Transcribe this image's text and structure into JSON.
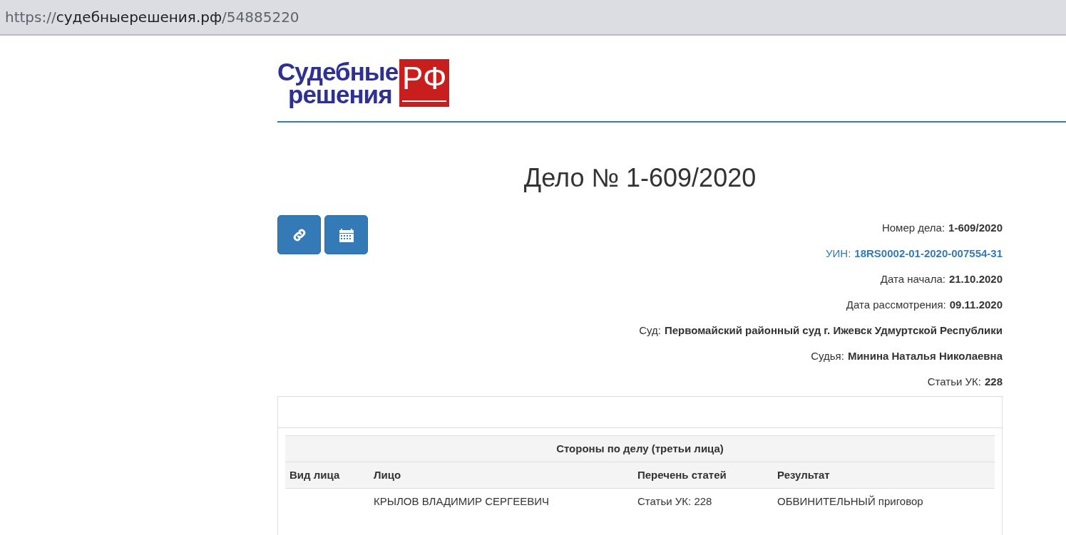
{
  "address_bar": {
    "scheme": "https://",
    "host": "судебныерешения.рф",
    "path": "/54885220"
  },
  "logo": {
    "line1": "Судебные",
    "line2": "решения",
    "badge": "РФ"
  },
  "title": "Дело № 1-609/2020",
  "action_buttons": [
    {
      "kind": "link"
    },
    {
      "kind": "calendar"
    }
  ],
  "fields": [
    {
      "label": "Номер дела:",
      "value": "1-609/2020",
      "kind": "text"
    },
    {
      "label": "УИН:",
      "value": "18RS0002-01-2020-007554-31",
      "kind": "link"
    },
    {
      "label": "Дата начала:",
      "value": "21.10.2020",
      "kind": "text"
    },
    {
      "label": "Дата рассмотрения:",
      "value": "09.11.2020",
      "kind": "text"
    },
    {
      "label": "Суд:",
      "value": "Первомайский районный суд г. Ижевск Удмуртской Республики",
      "kind": "text"
    },
    {
      "label": "Судья:",
      "value": "Минина Наталья Николаевна",
      "kind": "text"
    },
    {
      "label": "Статьи УК:",
      "value": "228",
      "kind": "text"
    }
  ],
  "parties_table": {
    "caption": "Стороны по делу (третьи лица)",
    "columns": [
      "Вид лица",
      "Лицо",
      "Перечень статей",
      "Результат"
    ],
    "rows": [
      [
        "",
        "КРЫЛОВ ВЛАДИМИР СЕРГЕЕВИЧ",
        "Статьи УК: 228",
        "ОБВИНИТЕЛЬНЫЙ приговор"
      ]
    ]
  }
}
